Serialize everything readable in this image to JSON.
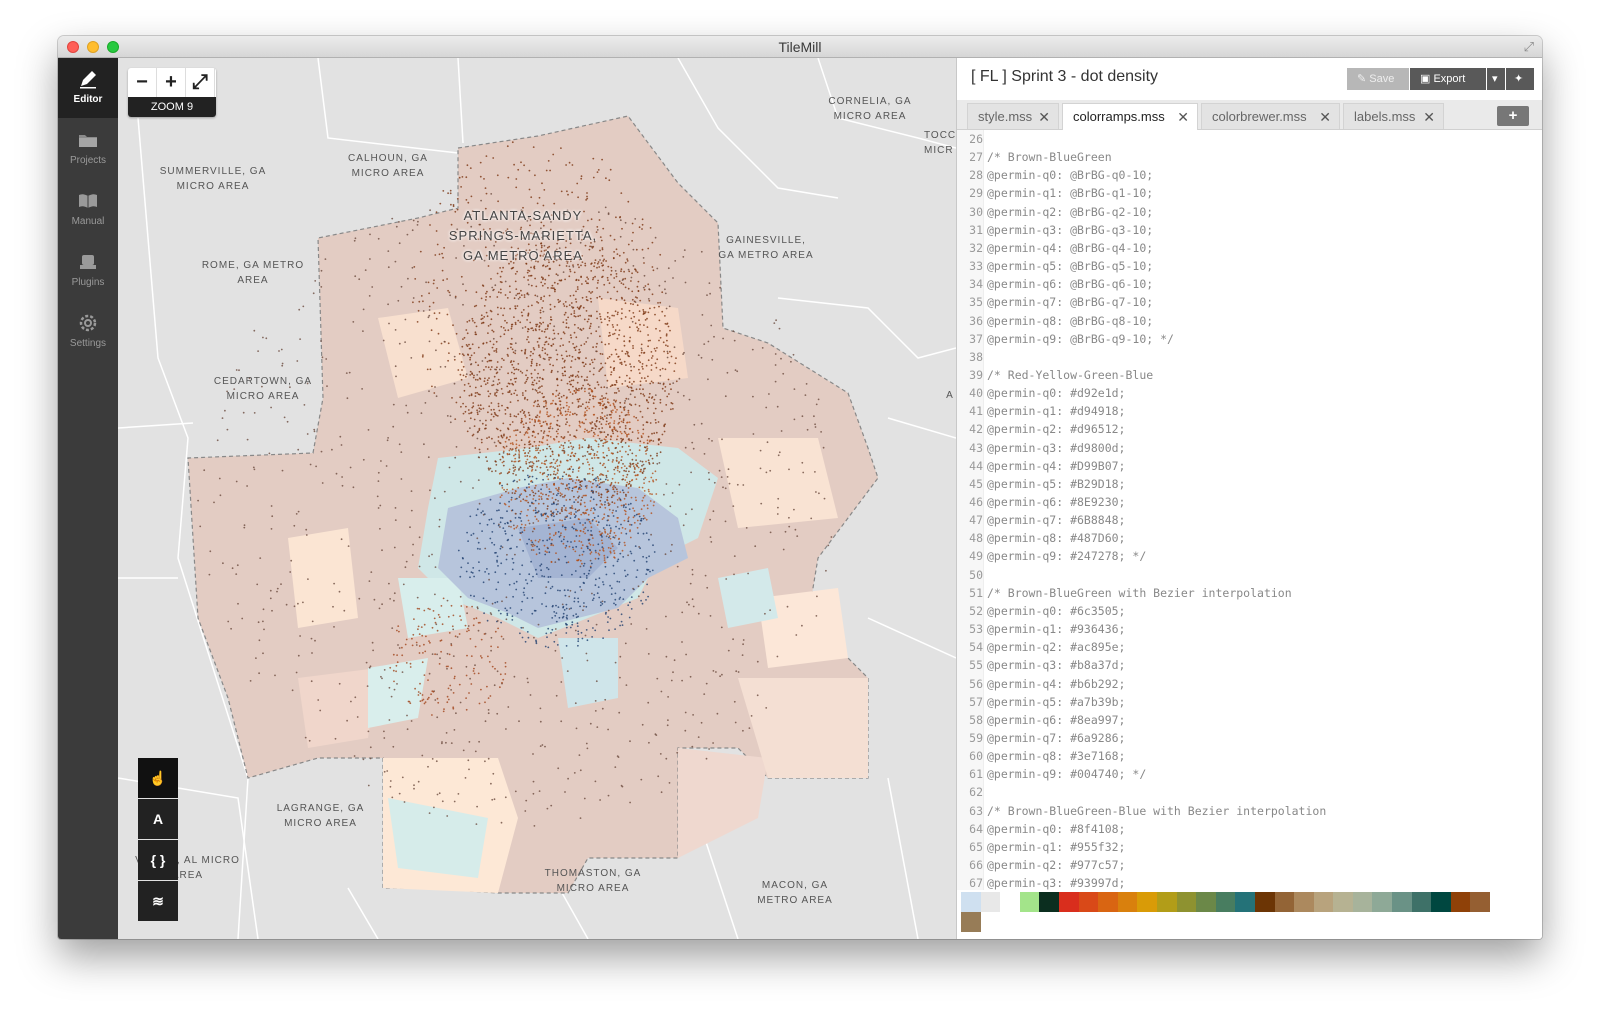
{
  "window": {
    "title": "TileMill"
  },
  "sidebar": {
    "items": [
      {
        "label": "Editor",
        "active": true,
        "icon": "pencil-icon"
      },
      {
        "label": "Projects",
        "active": false,
        "icon": "folder-icon"
      },
      {
        "label": "Manual",
        "active": false,
        "icon": "book-icon"
      },
      {
        "label": "Plugins",
        "active": false,
        "icon": "plug-icon"
      },
      {
        "label": "Settings",
        "active": false,
        "icon": "gear-icon"
      }
    ]
  },
  "map": {
    "zoom_minus": "−",
    "zoom_plus": "+",
    "zoom_extent": "⤢",
    "zoom_level": "ZOOM 9",
    "labels": {
      "atlanta": "ATLANTA-SANDY SPRINGS-MARIETTA, GA METRO AREA",
      "summerville": "SUMMERVILLE, GA MICRO AREA",
      "calhoun": "CALHOUN, GA MICRO AREA",
      "cornelia": "CORNELIA, GA MICRO AREA",
      "toccoa": "TOCC MICR",
      "gainesville": "GAINESVILLE, GA METRO AREA",
      "rome": "ROME, GA METRO AREA",
      "cedartown": "CEDARTOWN, GA MICRO AREA",
      "athens": "A",
      "lagrange": "LAGRANGE, GA MICRO AREA",
      "valley": "VALLEY, AL MICRO AREA",
      "thomaston": "THOMASTON, GA MICRO AREA",
      "macon": "MACON, GA METRO AREA"
    },
    "tools": [
      {
        "label": "☝",
        "icon": "hand-pointer-icon"
      },
      {
        "label": "A",
        "icon": "text-a-icon"
      },
      {
        "label": "{ }",
        "icon": "braces-icon"
      },
      {
        "label": "≋",
        "icon": "layers-icon"
      }
    ]
  },
  "editor": {
    "project_title": "[ FL ] Sprint 3 - dot density",
    "save_label": "Save",
    "export_label": "Export",
    "tabs": [
      {
        "label": "style.mss",
        "active": false
      },
      {
        "label": "colorramps.mss",
        "active": true
      },
      {
        "label": "colorbrewer.mss",
        "active": false
      },
      {
        "label": "labels.mss",
        "active": false
      }
    ],
    "add_tab": "+",
    "lines": [
      {
        "n": "26",
        "t": ""
      },
      {
        "n": "27",
        "t": "/* Brown-BlueGreen"
      },
      {
        "n": "28",
        "t": "@permin-q0: @BrBG-q0-10;"
      },
      {
        "n": "29",
        "t": "@permin-q1: @BrBG-q1-10;"
      },
      {
        "n": "30",
        "t": "@permin-q2: @BrBG-q2-10;"
      },
      {
        "n": "31",
        "t": "@permin-q3: @BrBG-q3-10;"
      },
      {
        "n": "32",
        "t": "@permin-q4: @BrBG-q4-10;"
      },
      {
        "n": "33",
        "t": "@permin-q5: @BrBG-q5-10;"
      },
      {
        "n": "34",
        "t": "@permin-q6: @BrBG-q6-10;"
      },
      {
        "n": "35",
        "t": "@permin-q7: @BrBG-q7-10;"
      },
      {
        "n": "36",
        "t": "@permin-q8: @BrBG-q8-10;"
      },
      {
        "n": "37",
        "t": "@permin-q9: @BrBG-q9-10; */"
      },
      {
        "n": "38",
        "t": ""
      },
      {
        "n": "39",
        "t": "/* Red-Yellow-Green-Blue"
      },
      {
        "n": "40",
        "t": "@permin-q0: #d92e1d;"
      },
      {
        "n": "41",
        "t": "@permin-q1: #d94918;"
      },
      {
        "n": "42",
        "t": "@permin-q2: #d96512;"
      },
      {
        "n": "43",
        "t": "@permin-q3: #d9800d;"
      },
      {
        "n": "44",
        "t": "@permin-q4: #D99B07;"
      },
      {
        "n": "45",
        "t": "@permin-q5: #B29D18;"
      },
      {
        "n": "46",
        "t": "@permin-q6: #8E9230;"
      },
      {
        "n": "47",
        "t": "@permin-q7: #6B8848;"
      },
      {
        "n": "48",
        "t": "@permin-q8: #487D60;"
      },
      {
        "n": "49",
        "t": "@permin-q9: #247278; */"
      },
      {
        "n": "50",
        "t": ""
      },
      {
        "n": "51",
        "t": "/* Brown-BlueGreen with Bezier interpolation"
      },
      {
        "n": "52",
        "t": "@permin-q0: #6c3505;"
      },
      {
        "n": "53",
        "t": "@permin-q1: #936436;"
      },
      {
        "n": "54",
        "t": "@permin-q2: #ac895e;"
      },
      {
        "n": "55",
        "t": "@permin-q3: #b8a37d;"
      },
      {
        "n": "56",
        "t": "@permin-q4: #b6b292;"
      },
      {
        "n": "57",
        "t": "@permin-q5: #a7b39b;"
      },
      {
        "n": "58",
        "t": "@permin-q6: #8ea997;"
      },
      {
        "n": "59",
        "t": "@permin-q7: #6a9286;"
      },
      {
        "n": "60",
        "t": "@permin-q8: #3e7168;"
      },
      {
        "n": "61",
        "t": "@permin-q9: #004740; */"
      },
      {
        "n": "62",
        "t": ""
      },
      {
        "n": "63",
        "t": "/* Brown-BlueGreen-Blue with Bezier interpolation"
      },
      {
        "n": "64",
        "t": "@permin-q0: #8f4108;"
      },
      {
        "n": "65",
        "t": "@permin-q1: #955f32;"
      },
      {
        "n": "66",
        "t": "@permin-q2: #977c57;"
      },
      {
        "n": "67",
        "t": "@permin-q3: #93997d;"
      }
    ],
    "palette": [
      "#cfe0f0",
      "#e8e8e8",
      "#ffffff",
      "#a3e48a",
      "#0b2e1f",
      "#d92e1d",
      "#d94918",
      "#d96512",
      "#d9800d",
      "#d99b07",
      "#b29d18",
      "#8e9230",
      "#6b8848",
      "#487d60",
      "#247278",
      "#6c3505",
      "#936436",
      "#ac895e",
      "#b8a37d",
      "#b6b292",
      "#a7b39b",
      "#8ea997",
      "#6a9286",
      "#3e7168",
      "#004740",
      "#8f4108",
      "#955f32",
      "#977c57"
    ]
  }
}
